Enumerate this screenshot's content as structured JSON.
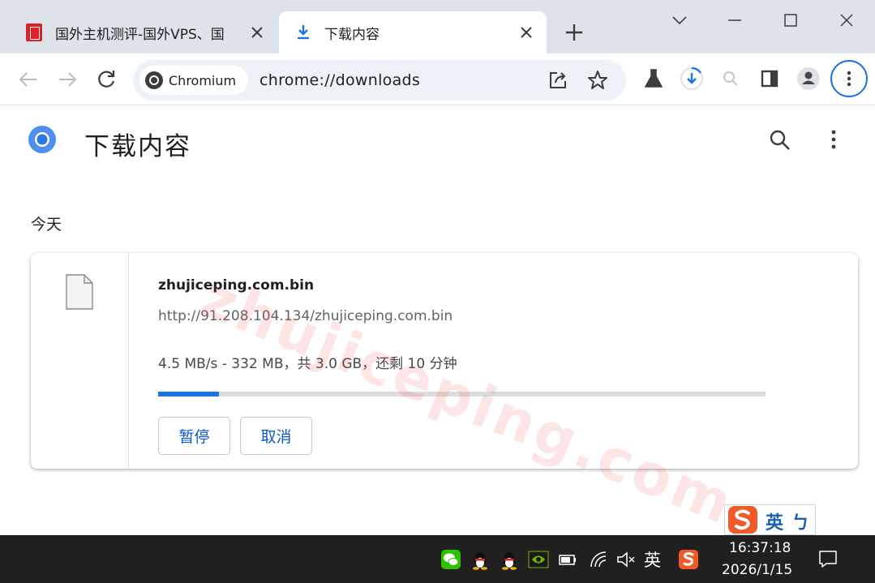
{
  "browser": {
    "tabs": [
      {
        "title": "国外主机测评-国外VPS、国",
        "active": false
      },
      {
        "title": "下载内容",
        "active": true
      }
    ],
    "site_chip": "Chromium",
    "url": "chrome://downloads"
  },
  "page": {
    "title": "下载内容",
    "section": "今天",
    "download": {
      "filename": "zhujiceping.com.bin",
      "source_url": "http://91.208.104.134/zhujiceping.com.bin",
      "status": "4.5 MB/s - 332 MB，共 3.0 GB，还剩 10 分钟",
      "progress_fraction": 0.1,
      "pause_label": "暂停",
      "cancel_label": "取消"
    }
  },
  "watermark": "zhujiceping.com",
  "ime": {
    "mode_label": "英",
    "punct_label": "ㄅ"
  },
  "taskbar": {
    "ime_indicator": "英",
    "time": "16:37:18",
    "date": "2026/1/15"
  },
  "colors": {
    "accent": "#1a73e8",
    "tabstrip": "#dee3eb",
    "omnibox": "#edf1f8",
    "taskbar": "#202020"
  }
}
